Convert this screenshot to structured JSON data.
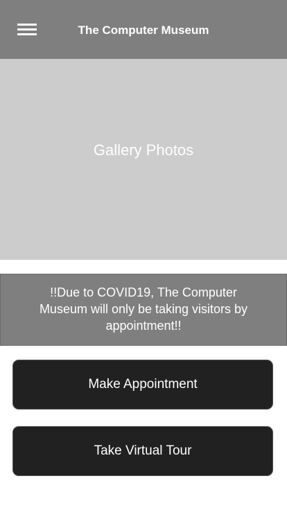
{
  "header": {
    "title": "The Computer Museum",
    "menu_icon": "hamburger-menu-icon"
  },
  "gallery": {
    "label": "Gallery Photos"
  },
  "notice": {
    "text": "!!Due to COVID19, The Computer Museum will only be taking visitors by appointment!!"
  },
  "actions": {
    "make_appointment_label": "Make Appointment",
    "virtual_tour_label": "Take Virtual Tour"
  },
  "colors": {
    "header_bg": "#7f7f7f",
    "gallery_bg": "#cccccc",
    "notice_bg": "#7f7f7f",
    "button_bg": "#212121",
    "text_on_dark": "#ffffff"
  }
}
